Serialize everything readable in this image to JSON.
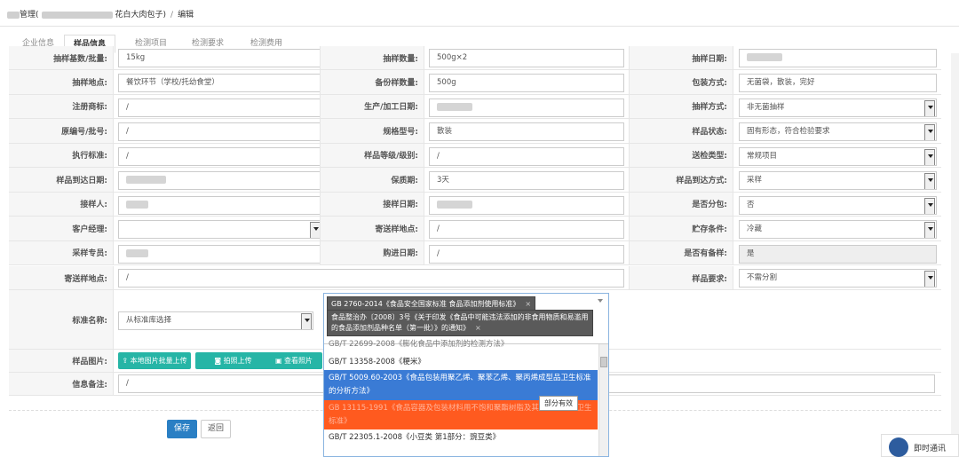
{
  "breadcrumb": {
    "prefix": "管理(",
    "suffix": "花白大肉包子)",
    "current": "编辑"
  },
  "tabs": [
    "企业信息",
    "样品信息",
    "检测项目",
    "检测要求",
    "检测费用"
  ],
  "rows": [
    [
      "抽样基数/批量:",
      "15kg",
      "抽样数量:",
      "500g×2",
      "抽样日期:",
      ""
    ],
    [
      "抽样地点:",
      "餐饮环节（学校/托幼食堂）",
      "备份样数量:",
      "500g",
      "包装方式:",
      "无菌袋，散装，完好"
    ],
    [
      "注册商标:",
      "/",
      "生产/加工日期:",
      "",
      "抽样方式:",
      "非无菌抽样"
    ],
    [
      "原编号/批号:",
      "/",
      "规格型号:",
      "散装",
      "样品状态:",
      "固有形态，符合检验要求"
    ],
    [
      "执行标准:",
      "/",
      "样品等级/级别:",
      "/",
      "送检类型:",
      "常规项目"
    ],
    [
      "样品到达日期:",
      "",
      "保质期:",
      "3天",
      "样品到达方式:",
      "采样"
    ],
    [
      "接样人:",
      "",
      "接样日期:",
      "",
      "是否分包:",
      "否"
    ],
    [
      "客户经理:",
      "",
      "寄送样地点:",
      "/",
      "贮存条件:",
      "冷藏"
    ],
    [
      "采样专员:",
      "",
      "购进日期:",
      "/",
      "是否有备样:",
      "是"
    ]
  ],
  "row10": {
    "label": "寄送样地点:",
    "value": "/",
    "label2": "样品要求:",
    "value2": "不需分割"
  },
  "standard": {
    "label": "标准名称:",
    "select": "从标准库选择"
  },
  "photo": {
    "label": "样品图片:",
    "btn1": "本地图片批量上传",
    "btn2": "拍照上传",
    "btn3": "查看照片"
  },
  "remark": {
    "label": "信息备注:",
    "value": "/"
  },
  "dropdown": {
    "tag1": "GB 2760-2014《食品安全国家标准 食品添加剂使用标准》",
    "tag2": "食品整治办〔2008〕3号《关于印发《食品中可能违法添加的非食用物质和易滥用的食品添加剂品种名单（第一批）》的通知》",
    "options": [
      "GB/T 22699-2008《膨化食品中添加剂的检测方法》",
      "GB/T 13358-2008《粳米》",
      "GB/T 5009.60-2003《食品包装用聚乙烯、聚苯乙烯、聚丙烯成型品卫生标准的分析方法》",
      "GB 13115-1991《食品容器及包装材料用不饱和聚酯树脂及其玻璃钢制品卫生标准》",
      "GB/T 22305.1-2008《小豆类 第1部分：豌豆类》"
    ],
    "tooltip": "部分有效"
  },
  "buttons": {
    "save": "保存",
    "back": "返回"
  },
  "chat": "即时通讯",
  "colors": {
    "teal": "#26b5a6",
    "blue": "#2a7fc4",
    "orange": "#ff5a1f",
    "selected": "#3a7bd5"
  }
}
